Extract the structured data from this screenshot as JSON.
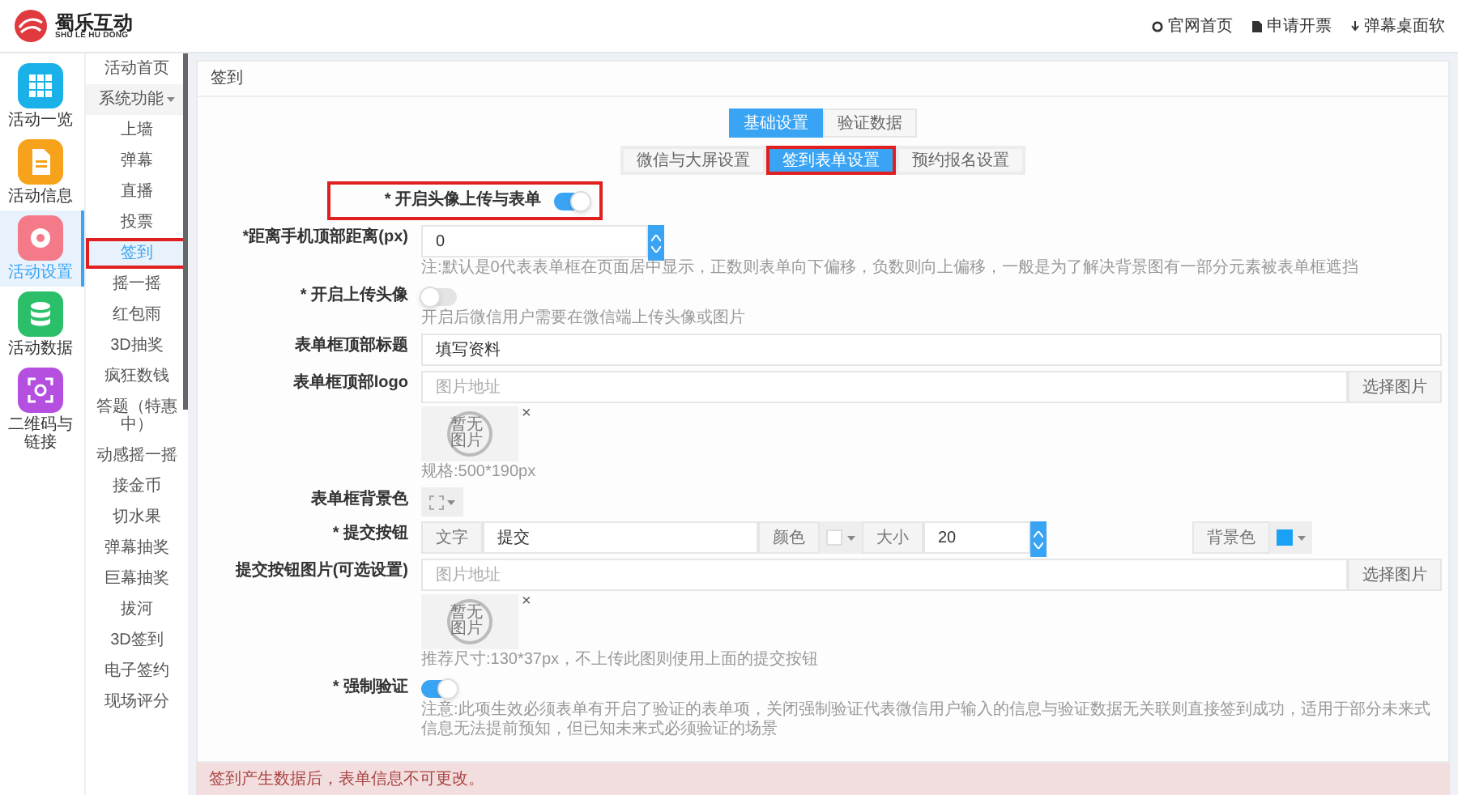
{
  "header": {
    "logo_text": "蜀乐互动",
    "logo_subtitle": "SHU LE HU DONG",
    "links": [
      {
        "label": "官网首页"
      },
      {
        "label": "申请开票"
      },
      {
        "label": "弹幕桌面软"
      }
    ]
  },
  "rail": [
    {
      "label": "活动一览",
      "color": "#1ab0e8",
      "selected": false
    },
    {
      "label": "活动信息",
      "color": "#f7a21b",
      "selected": false
    },
    {
      "label": "活动设置",
      "color": "#f47a8a",
      "selected": true
    },
    {
      "label": "活动数据",
      "color": "#2bbf6a",
      "selected": false
    },
    {
      "label": "二维码与链接",
      "color": "#b44fe0",
      "selected": false
    }
  ],
  "menu": [
    {
      "label": "活动首页",
      "selected": false
    },
    {
      "label": "系统功能",
      "selected": false,
      "expanded": true,
      "children": [
        {
          "label": "上墙",
          "selected": false
        },
        {
          "label": "弹幕",
          "selected": false
        },
        {
          "label": "直播",
          "selected": false
        },
        {
          "label": "投票",
          "selected": false
        },
        {
          "label": "签到",
          "selected": true,
          "highlighted": true
        },
        {
          "label": "摇一摇",
          "selected": false
        },
        {
          "label": "红包雨",
          "selected": false
        },
        {
          "label": "3D抽奖",
          "selected": false
        },
        {
          "label": "疯狂数钱",
          "selected": false
        },
        {
          "label": "答题（特惠中）",
          "selected": false
        },
        {
          "label": "动感摇一摇",
          "selected": false
        },
        {
          "label": "接金币",
          "selected": false
        },
        {
          "label": "切水果",
          "selected": false
        },
        {
          "label": "弹幕抽奖",
          "selected": false
        },
        {
          "label": "巨幕抽奖",
          "selected": false
        },
        {
          "label": "拔河",
          "selected": false
        },
        {
          "label": "3D签到",
          "selected": false
        },
        {
          "label": "电子签约",
          "selected": false
        },
        {
          "label": "现场评分",
          "selected": false
        }
      ]
    }
  ],
  "panel": {
    "title": "签到",
    "tabs": [
      {
        "label": "基础设置",
        "selected": true
      },
      {
        "label": "验证数据",
        "selected": false
      }
    ],
    "subtabs": [
      {
        "label": "微信与大屏设置",
        "selected": false,
        "highlighted": false
      },
      {
        "label": "签到表单设置",
        "selected": true,
        "highlighted": true
      },
      {
        "label": "预约报名设置",
        "selected": false,
        "highlighted": false
      }
    ],
    "fields": [
      {
        "kind": "toggle",
        "label": "* 开启头像上传与表单",
        "on": true,
        "highlighted": true
      },
      {
        "kind": "number",
        "label": "*距离手机顶部距离(px)",
        "value": "0",
        "help": "注:默认是0代表表单框在页面居中显示，正数则表单向下偏移，负数则向上偏移，一般是为了解决背景图有一部分元素被表单框遮挡"
      },
      {
        "kind": "toggle",
        "label": "* 开启上传头像",
        "on": false,
        "highlighted": false,
        "help": "开启后微信用户需要在微信端上传头像或图片"
      },
      {
        "kind": "text",
        "label": "表单框顶部标题",
        "value": "填写资料"
      },
      {
        "kind": "image",
        "label": "表单框顶部logo",
        "placeholder": "图片地址",
        "button": "选择图片",
        "preview": "暂无图片",
        "remove": "×",
        "help": "规格:500*190px"
      },
      {
        "kind": "color",
        "label": "表单框背景色"
      },
      {
        "kind": "submit",
        "label": "* 提交按钮",
        "text_addon": "文字",
        "value": "提交",
        "color_addon": "颜色",
        "size_addon": "大小",
        "size": "20",
        "bg_addon": "背景色"
      },
      {
        "kind": "image",
        "label": "提交按钮图片(可选设置)",
        "placeholder": "图片地址",
        "button": "选择图片",
        "preview": "暂无图片",
        "remove": "×",
        "help": "推荐尺寸:130*37px，不上传此图则使用上面的提交按钮"
      },
      {
        "kind": "toggle",
        "label": "* 强制验证",
        "on": true,
        "highlighted": false,
        "help": "注意:此项生效必须表单有开启了验证的表单项，关闭强制验证代表微信用户输入的信息与验证数据无关联则直接签到成功，适用于部分未来式信息无法提前预知，但已知未来式必须验证的场景"
      }
    ],
    "alert": "签到产生数据后，表单信息不可更改。"
  }
}
